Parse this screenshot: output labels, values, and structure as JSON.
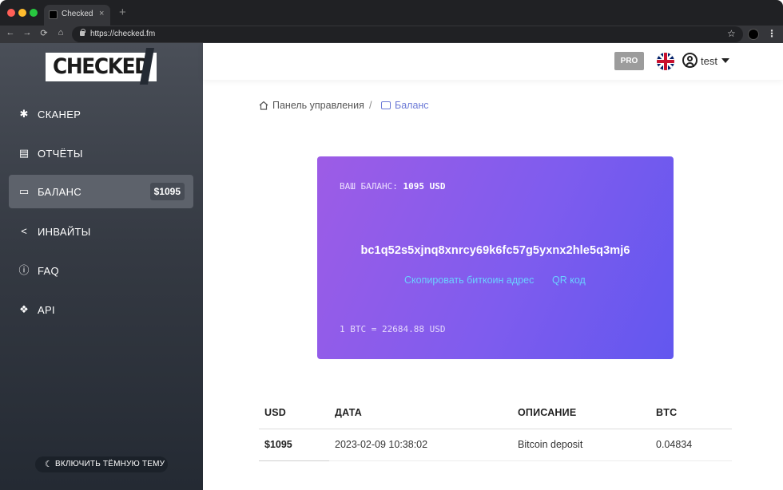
{
  "browser": {
    "tab_title": "Checked",
    "tab_close": "×",
    "new_tab": "+",
    "url": "https://checked.fm",
    "back": "←",
    "forward": "→",
    "reload": "⟳",
    "home": "⌂",
    "bookmark": "☆",
    "menu": "⋮"
  },
  "sidebar": {
    "logo": "CHECKED",
    "items": [
      {
        "label": "СКАНЕР",
        "icon": "bug-icon",
        "glyph": "✱"
      },
      {
        "label": "ОТЧЁТЫ",
        "icon": "reports-icon",
        "glyph": "▤"
      },
      {
        "label": "БАЛАНС",
        "icon": "wallet-icon",
        "glyph": "▭",
        "badge": "$1095",
        "active": true
      },
      {
        "label": "ИНВАЙТЫ",
        "icon": "share-icon",
        "glyph": "<"
      },
      {
        "label": "FAQ",
        "icon": "info-icon",
        "glyph": "ⓘ"
      },
      {
        "label": "API",
        "icon": "cubes-icon",
        "glyph": "❖"
      }
    ],
    "theme_toggle": "ВКЛЮЧИТЬ ТЁМНУЮ ТЕМУ",
    "theme_icon": "☾"
  },
  "header": {
    "pro_badge": "PRO",
    "username": "test"
  },
  "breadcrumb": {
    "home": "Панель управления",
    "separator": "/",
    "current": "Баланс"
  },
  "card": {
    "balance_label": "ВАШ БАЛАНС:",
    "balance_value": "1095 USD",
    "address": "bc1q52s5xjnq8xnrcy69k6fc57g5yxnx2hle5q3mj6",
    "copy_link": "Скопировать биткоин адрес",
    "qr_link": "QR код",
    "rate": "1 BTC = 22684.88 USD"
  },
  "table": {
    "headers": [
      "USD",
      "ДАТА",
      "ОПИСАНИЕ",
      "BTC"
    ],
    "rows": [
      [
        "$1095",
        "2023-02-09 10:38:02",
        "Bitcoin deposit",
        "0.04834"
      ]
    ]
  },
  "colors": {
    "card_gradient_start": "#9d5ce6",
    "card_gradient_end": "#6257ef",
    "link_color": "#6bd0ff",
    "breadcrumb_active": "#6b79d6"
  }
}
